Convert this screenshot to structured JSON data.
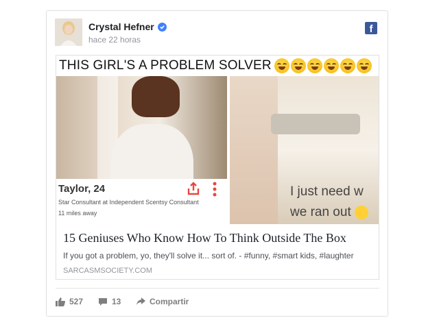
{
  "post": {
    "author": "Crystal Hefner",
    "time": "hace 22 horas",
    "platform_icon": "facebook-icon",
    "brand_color": "#3b5998"
  },
  "meme": {
    "caption": "THIS GIRL'S A PROBLEM SOLVER",
    "emoji_icon": "laughing-tears-emoji",
    "emoji_count": 6,
    "profile": {
      "name": "Taylor, 24",
      "description": "Star Consultant at Independent Scentsy Consultant",
      "distance": "11 miles away"
    },
    "right_text_line1": "I just need w",
    "right_text_line2": "we ran out"
  },
  "link": {
    "title": "15 Geniuses Who Know How To Think Outside The Box",
    "description": "If you got a problem, yo, they'll solve it... sort of. - #funny, #smart kids, #laughter",
    "domain": "SARCASMSOCIETY.COM"
  },
  "actions": {
    "likes": "527",
    "comments": "13",
    "share_label": "Compartir"
  }
}
